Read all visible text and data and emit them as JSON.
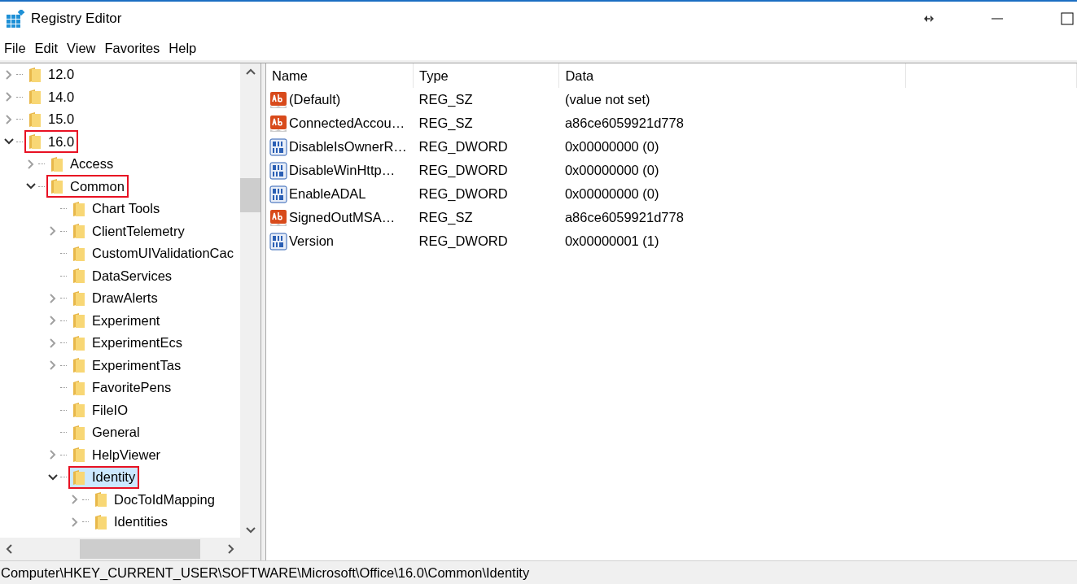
{
  "window": {
    "title": "Registry Editor"
  },
  "menu": [
    "File",
    "Edit",
    "View",
    "Favorites",
    "Help"
  ],
  "tree": [
    {
      "label": "12.0",
      "expandable": true,
      "expanded": false,
      "selected": false,
      "marked": false
    },
    {
      "label": "14.0",
      "expandable": true,
      "expanded": false,
      "selected": false,
      "marked": false
    },
    {
      "label": "15.0",
      "expandable": true,
      "expanded": false,
      "selected": false,
      "marked": false
    },
    {
      "label": "16.0",
      "expandable": true,
      "expanded": true,
      "selected": false,
      "marked": true,
      "children": [
        {
          "label": "Access",
          "expandable": true,
          "expanded": false,
          "selected": false,
          "marked": false
        },
        {
          "label": "Common",
          "expandable": true,
          "expanded": true,
          "selected": false,
          "marked": true,
          "children": [
            {
              "label": "Chart Tools",
              "expandable": false,
              "expanded": false,
              "selected": false,
              "marked": false
            },
            {
              "label": "ClientTelemetry",
              "expandable": true,
              "expanded": false,
              "selected": false,
              "marked": false
            },
            {
              "label": "CustomUIValidationCac",
              "expandable": false,
              "expanded": false,
              "selected": false,
              "marked": false
            },
            {
              "label": "DataServices",
              "expandable": false,
              "expanded": false,
              "selected": false,
              "marked": false
            },
            {
              "label": "DrawAlerts",
              "expandable": true,
              "expanded": false,
              "selected": false,
              "marked": false
            },
            {
              "label": "Experiment",
              "expandable": true,
              "expanded": false,
              "selected": false,
              "marked": false
            },
            {
              "label": "ExperimentEcs",
              "expandable": true,
              "expanded": false,
              "selected": false,
              "marked": false
            },
            {
              "label": "ExperimentTas",
              "expandable": true,
              "expanded": false,
              "selected": false,
              "marked": false
            },
            {
              "label": "FavoritePens",
              "expandable": false,
              "expanded": false,
              "selected": false,
              "marked": false
            },
            {
              "label": "FileIO",
              "expandable": false,
              "expanded": false,
              "selected": false,
              "marked": false
            },
            {
              "label": "General",
              "expandable": false,
              "expanded": false,
              "selected": false,
              "marked": false
            },
            {
              "label": "HelpViewer",
              "expandable": true,
              "expanded": false,
              "selected": false,
              "marked": false
            },
            {
              "label": "Identity",
              "expandable": true,
              "expanded": true,
              "selected": true,
              "marked": true,
              "children": [
                {
                  "label": "DocToIdMapping",
                  "expandable": true,
                  "expanded": false,
                  "selected": false,
                  "marked": false
                },
                {
                  "label": "Identities",
                  "expandable": true,
                  "expanded": false,
                  "selected": false,
                  "marked": false
                }
              ]
            }
          ]
        }
      ]
    }
  ],
  "table": {
    "columns": [
      "Name",
      "Type",
      "Data"
    ],
    "rows": [
      {
        "kind": "string",
        "name": "(Default)",
        "type": "REG_SZ",
        "data": "(value not set)"
      },
      {
        "kind": "string",
        "name": "ConnectedAccou…",
        "type": "REG_SZ",
        "data": "a86ce6059921d778"
      },
      {
        "kind": "binary",
        "name": "DisableIsOwnerR…",
        "type": "REG_DWORD",
        "data": "0x00000000 (0)"
      },
      {
        "kind": "binary",
        "name": "DisableWinHttp…",
        "type": "REG_DWORD",
        "data": "0x00000000 (0)"
      },
      {
        "kind": "binary",
        "name": "EnableADAL",
        "type": "REG_DWORD",
        "data": "0x00000000 (0)"
      },
      {
        "kind": "string",
        "name": "SignedOutMSA…",
        "type": "REG_SZ",
        "data": "a86ce6059921d778"
      },
      {
        "kind": "binary",
        "name": "Version",
        "type": "REG_DWORD",
        "data": "0x00000001 (1)"
      }
    ]
  },
  "status_bar": "Computer\\HKEY_CURRENT_USER\\SOFTWARE\\Microsoft\\Office\\16.0\\Common\\Identity"
}
